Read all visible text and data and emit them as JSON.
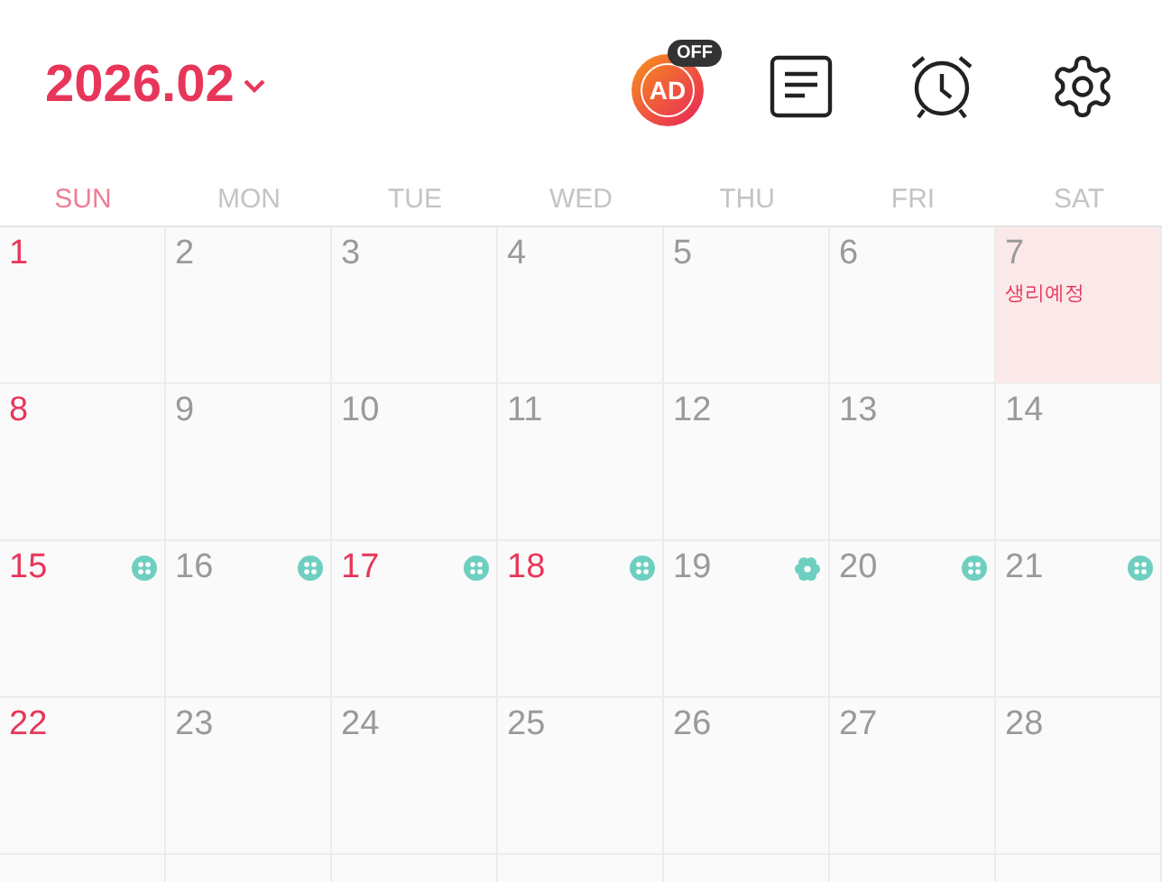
{
  "header": {
    "title": "2026.02",
    "ad_label": "AD",
    "ad_badge": "OFF"
  },
  "weekdays": [
    {
      "label": "SUN",
      "holiday": true
    },
    {
      "label": "MON",
      "holiday": false
    },
    {
      "label": "TUE",
      "holiday": false
    },
    {
      "label": "WED",
      "holiday": false
    },
    {
      "label": "THU",
      "holiday": false
    },
    {
      "label": "FRI",
      "holiday": false
    },
    {
      "label": "SAT",
      "holiday": false
    }
  ],
  "weeks": [
    [
      {
        "day": "1",
        "holiday": true,
        "highlighted": false
      },
      {
        "day": "2",
        "holiday": false,
        "highlighted": false
      },
      {
        "day": "3",
        "holiday": false,
        "highlighted": false
      },
      {
        "day": "4",
        "holiday": false,
        "highlighted": false
      },
      {
        "day": "5",
        "holiday": false,
        "highlighted": false
      },
      {
        "day": "6",
        "holiday": false,
        "highlighted": false
      },
      {
        "day": "7",
        "holiday": false,
        "highlighted": true,
        "note": "생리예정"
      }
    ],
    [
      {
        "day": "8",
        "holiday": true,
        "highlighted": false
      },
      {
        "day": "9",
        "holiday": false,
        "highlighted": false
      },
      {
        "day": "10",
        "holiday": false,
        "highlighted": false
      },
      {
        "day": "11",
        "holiday": false,
        "highlighted": false
      },
      {
        "day": "12",
        "holiday": false,
        "highlighted": false
      },
      {
        "day": "13",
        "holiday": false,
        "highlighted": false
      },
      {
        "day": "14",
        "holiday": false,
        "highlighted": false
      }
    ],
    [
      {
        "day": "15",
        "holiday": true,
        "highlighted": false,
        "marker": {
          "kind": "pill"
        }
      },
      {
        "day": "16",
        "holiday": false,
        "highlighted": false,
        "marker": {
          "kind": "pill"
        }
      },
      {
        "day": "17",
        "holiday": true,
        "highlighted": false,
        "marker": {
          "kind": "pill"
        }
      },
      {
        "day": "18",
        "holiday": true,
        "highlighted": false,
        "marker": {
          "kind": "pill"
        }
      },
      {
        "day": "19",
        "holiday": false,
        "highlighted": false,
        "marker": {
          "kind": "flower"
        }
      },
      {
        "day": "20",
        "holiday": false,
        "highlighted": false,
        "marker": {
          "kind": "pill"
        }
      },
      {
        "day": "21",
        "holiday": false,
        "highlighted": false,
        "marker": {
          "kind": "pill"
        }
      }
    ],
    [
      {
        "day": "22",
        "holiday": true,
        "highlighted": false
      },
      {
        "day": "23",
        "holiday": false,
        "highlighted": false
      },
      {
        "day": "24",
        "holiday": false,
        "highlighted": false
      },
      {
        "day": "25",
        "holiday": false,
        "highlighted": false
      },
      {
        "day": "26",
        "holiday": false,
        "highlighted": false
      },
      {
        "day": "27",
        "holiday": false,
        "highlighted": false
      },
      {
        "day": "28",
        "holiday": false,
        "highlighted": false
      }
    ]
  ]
}
